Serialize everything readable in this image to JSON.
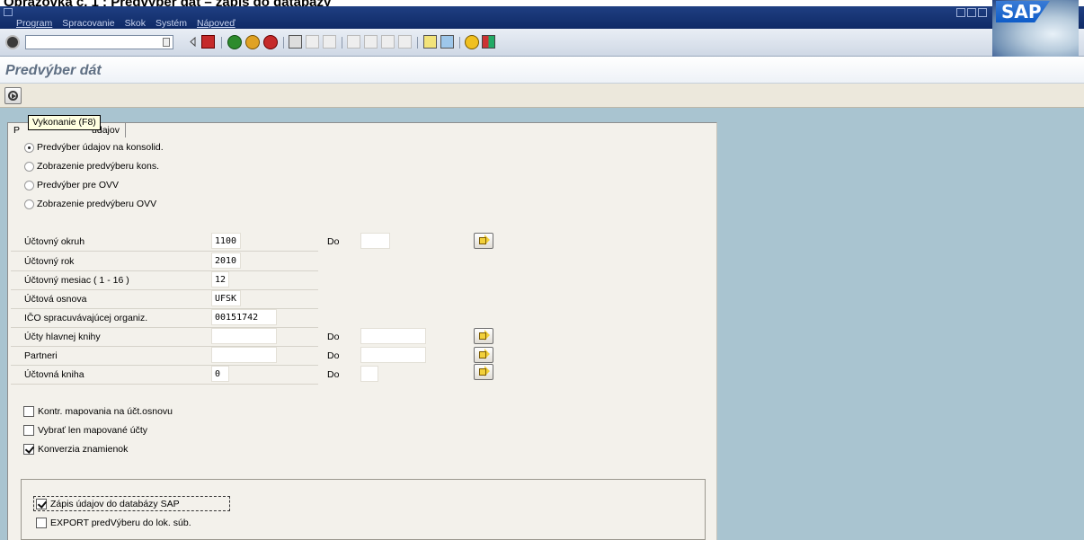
{
  "caption": "Obrazovka č. 1 : Predvýber dát – zápis do databázy",
  "menu": {
    "items": [
      "Program",
      "Spracovanie",
      "Skok",
      "Systém",
      "Nápoveď"
    ]
  },
  "logo": "SAP",
  "page_title": "Predvýber dát",
  "tooltip": "Vykonanie  (F8)",
  "tab_label": "Predvýber údajov",
  "tab_visible_start": "P",
  "tab_visible_end": "údajov",
  "radios": [
    {
      "label": "Predvýber údajov na konsolid.",
      "selected": true
    },
    {
      "label": "Zobrazenie predvýberu kons.",
      "selected": false
    },
    {
      "label": "Predvýber pre OVV",
      "selected": false
    },
    {
      "label": "Zobrazenie predvýberu OVV",
      "selected": false
    }
  ],
  "fields": [
    {
      "label": "Účtovný okruh",
      "value": "1100",
      "to_label": "Do",
      "to_value": ""
    },
    {
      "label": "Účtovný rok",
      "value": "2010"
    },
    {
      "label": "Účtovný mesiac ( 1 - 16 )",
      "value": "12"
    },
    {
      "label": "Účtová osnova",
      "value": "UFSK"
    },
    {
      "label": "IČO spracuvávajúcej organiz.",
      "value": "00151742"
    },
    {
      "label": "Účty hlavnej knihy",
      "value": "",
      "to_label": "Do",
      "to_value": ""
    },
    {
      "label": "Partneri",
      "value": "",
      "to_label": "Do",
      "to_value": ""
    },
    {
      "label": "Účtovná kniha",
      "value": "0",
      "to_label": "Do",
      "to_value": ""
    }
  ],
  "checkboxes": [
    {
      "label": "Kontr. mapovania na účt.osnovu",
      "checked": false
    },
    {
      "label": "Vybrať len mapované účty",
      "checked": false
    },
    {
      "label": "Konverzia znamienok",
      "checked": true
    }
  ],
  "group_checkboxes": [
    {
      "label": "Zápis údajov do databázy SAP",
      "checked": true
    },
    {
      "label": "EXPORT predVýberu do lok. súb.",
      "checked": false
    }
  ],
  "colors": {
    "menubar": "#1f3f82",
    "workarea": "#a9c4d0",
    "panel": "#f3f1eb",
    "title": "#5f6f83"
  }
}
